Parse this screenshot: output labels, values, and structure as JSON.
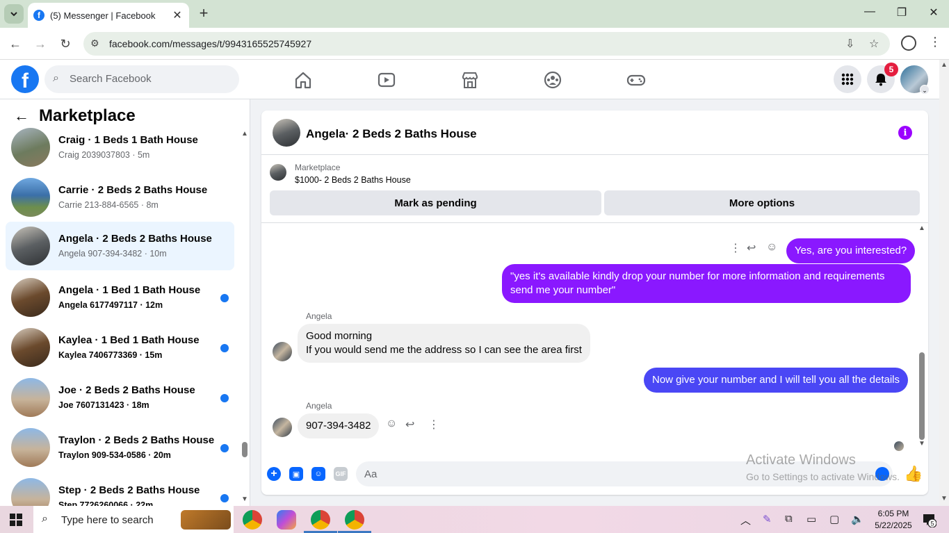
{
  "browser": {
    "tab_title": "(5) Messenger | Facebook",
    "tab_close": "✕",
    "new_tab": "+",
    "url": "facebook.com/messages/t/9943165525745927",
    "win_min": "—",
    "win_max": "❐",
    "win_close": "✕",
    "back": "←",
    "forward": "→",
    "reload": "↻"
  },
  "fb": {
    "logo": "f",
    "search_placeholder": "Search Facebook",
    "notification_count": "5",
    "nav_icons": [
      "home-icon",
      "watch-icon",
      "marketplace-icon",
      "groups-icon",
      "gaming-icon"
    ]
  },
  "sidebar": {
    "title": "Marketplace",
    "back": "←",
    "conversations": [
      {
        "name": "Craig · 1 Beds 1 Bath House",
        "sub": "Craig 2039037803 · 5m",
        "unread": false,
        "active": false
      },
      {
        "name": "Carrie · 2 Beds 2 Baths House",
        "sub": "Carrie 213-884-6565 · 8m",
        "unread": false,
        "active": false
      },
      {
        "name": "Angela · 2 Beds 2 Baths House",
        "sub": "Angela 907-394-3482 · 10m",
        "unread": false,
        "active": true
      },
      {
        "name": "Angela · 1 Bed 1 Bath House",
        "sub": "Angela 6177497117 · 12m",
        "unread": true,
        "active": false
      },
      {
        "name": "Kaylea · 1 Bed 1 Bath House",
        "sub": "Kaylea 7406773369 · 15m",
        "unread": true,
        "active": false
      },
      {
        "name": "Joe · 2 Beds 2 Baths House",
        "sub": "Joe 7607131423 · 18m",
        "unread": true,
        "active": false
      },
      {
        "name": "Traylon · 2 Beds 2 Baths House",
        "sub": "Traylon 909-534-0586 · 20m",
        "unread": true,
        "active": false
      },
      {
        "name": "Step · 2 Beds 2 Baths House",
        "sub": "Step 7726260066 · 22m",
        "unread": true,
        "active": false
      }
    ]
  },
  "chat": {
    "title": "Angela· 2 Beds 2 Baths House",
    "info": "i",
    "marketplace_label": "Marketplace",
    "listing": "$1000- 2 Beds 2 Baths House",
    "mark_pending": "Mark as pending",
    "more_options": "More options",
    "messages": {
      "m1": "Yes, are you interested?",
      "m2": "\"yes it's available kindly drop your number for more information and requirements send me your number\"",
      "sender1": "Angela",
      "m3_line1": "Good morning",
      "m3_line2": "If you would send me the address so I can see the area first",
      "m4": "Now give your number and I will tell you all the details",
      "sender2": "Angela",
      "m5": "907-394-3482"
    },
    "composer_placeholder": "Aa",
    "gif": "GIF"
  },
  "watermark": {
    "line1": "Activate Windows",
    "line2": "Go to Settings to activate Windows."
  },
  "taskbar": {
    "search_placeholder": "Type here to search",
    "time": "6:05 PM",
    "date": "5/22/2025",
    "notif_count": "5"
  },
  "colors": {
    "fb_blue": "#1877f2",
    "purple_bubble": "#8a18ff",
    "blue_bubble": "#4a47f5",
    "notif_red": "#e41e3f"
  }
}
